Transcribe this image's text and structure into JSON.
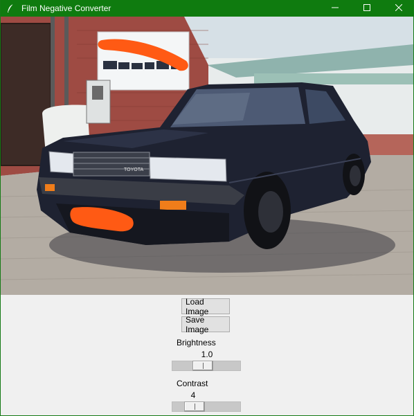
{
  "window": {
    "title": "Film Negative Converter",
    "icon": "feather-icon",
    "controls": [
      "minimize-icon",
      "maximize-icon",
      "close-icon"
    ],
    "title_bar_color": "#0f7b0f"
  },
  "image": {
    "description_icon": "photo-preview",
    "car_badge": "TOYOTA"
  },
  "buttons": {
    "load_label": "Load Image",
    "save_label": "Save Image"
  },
  "brightness": {
    "label": "Brightness",
    "value": "1.0",
    "level": 0.42
  },
  "contrast": {
    "label": "Contrast",
    "value": "4",
    "level": 0.25
  }
}
